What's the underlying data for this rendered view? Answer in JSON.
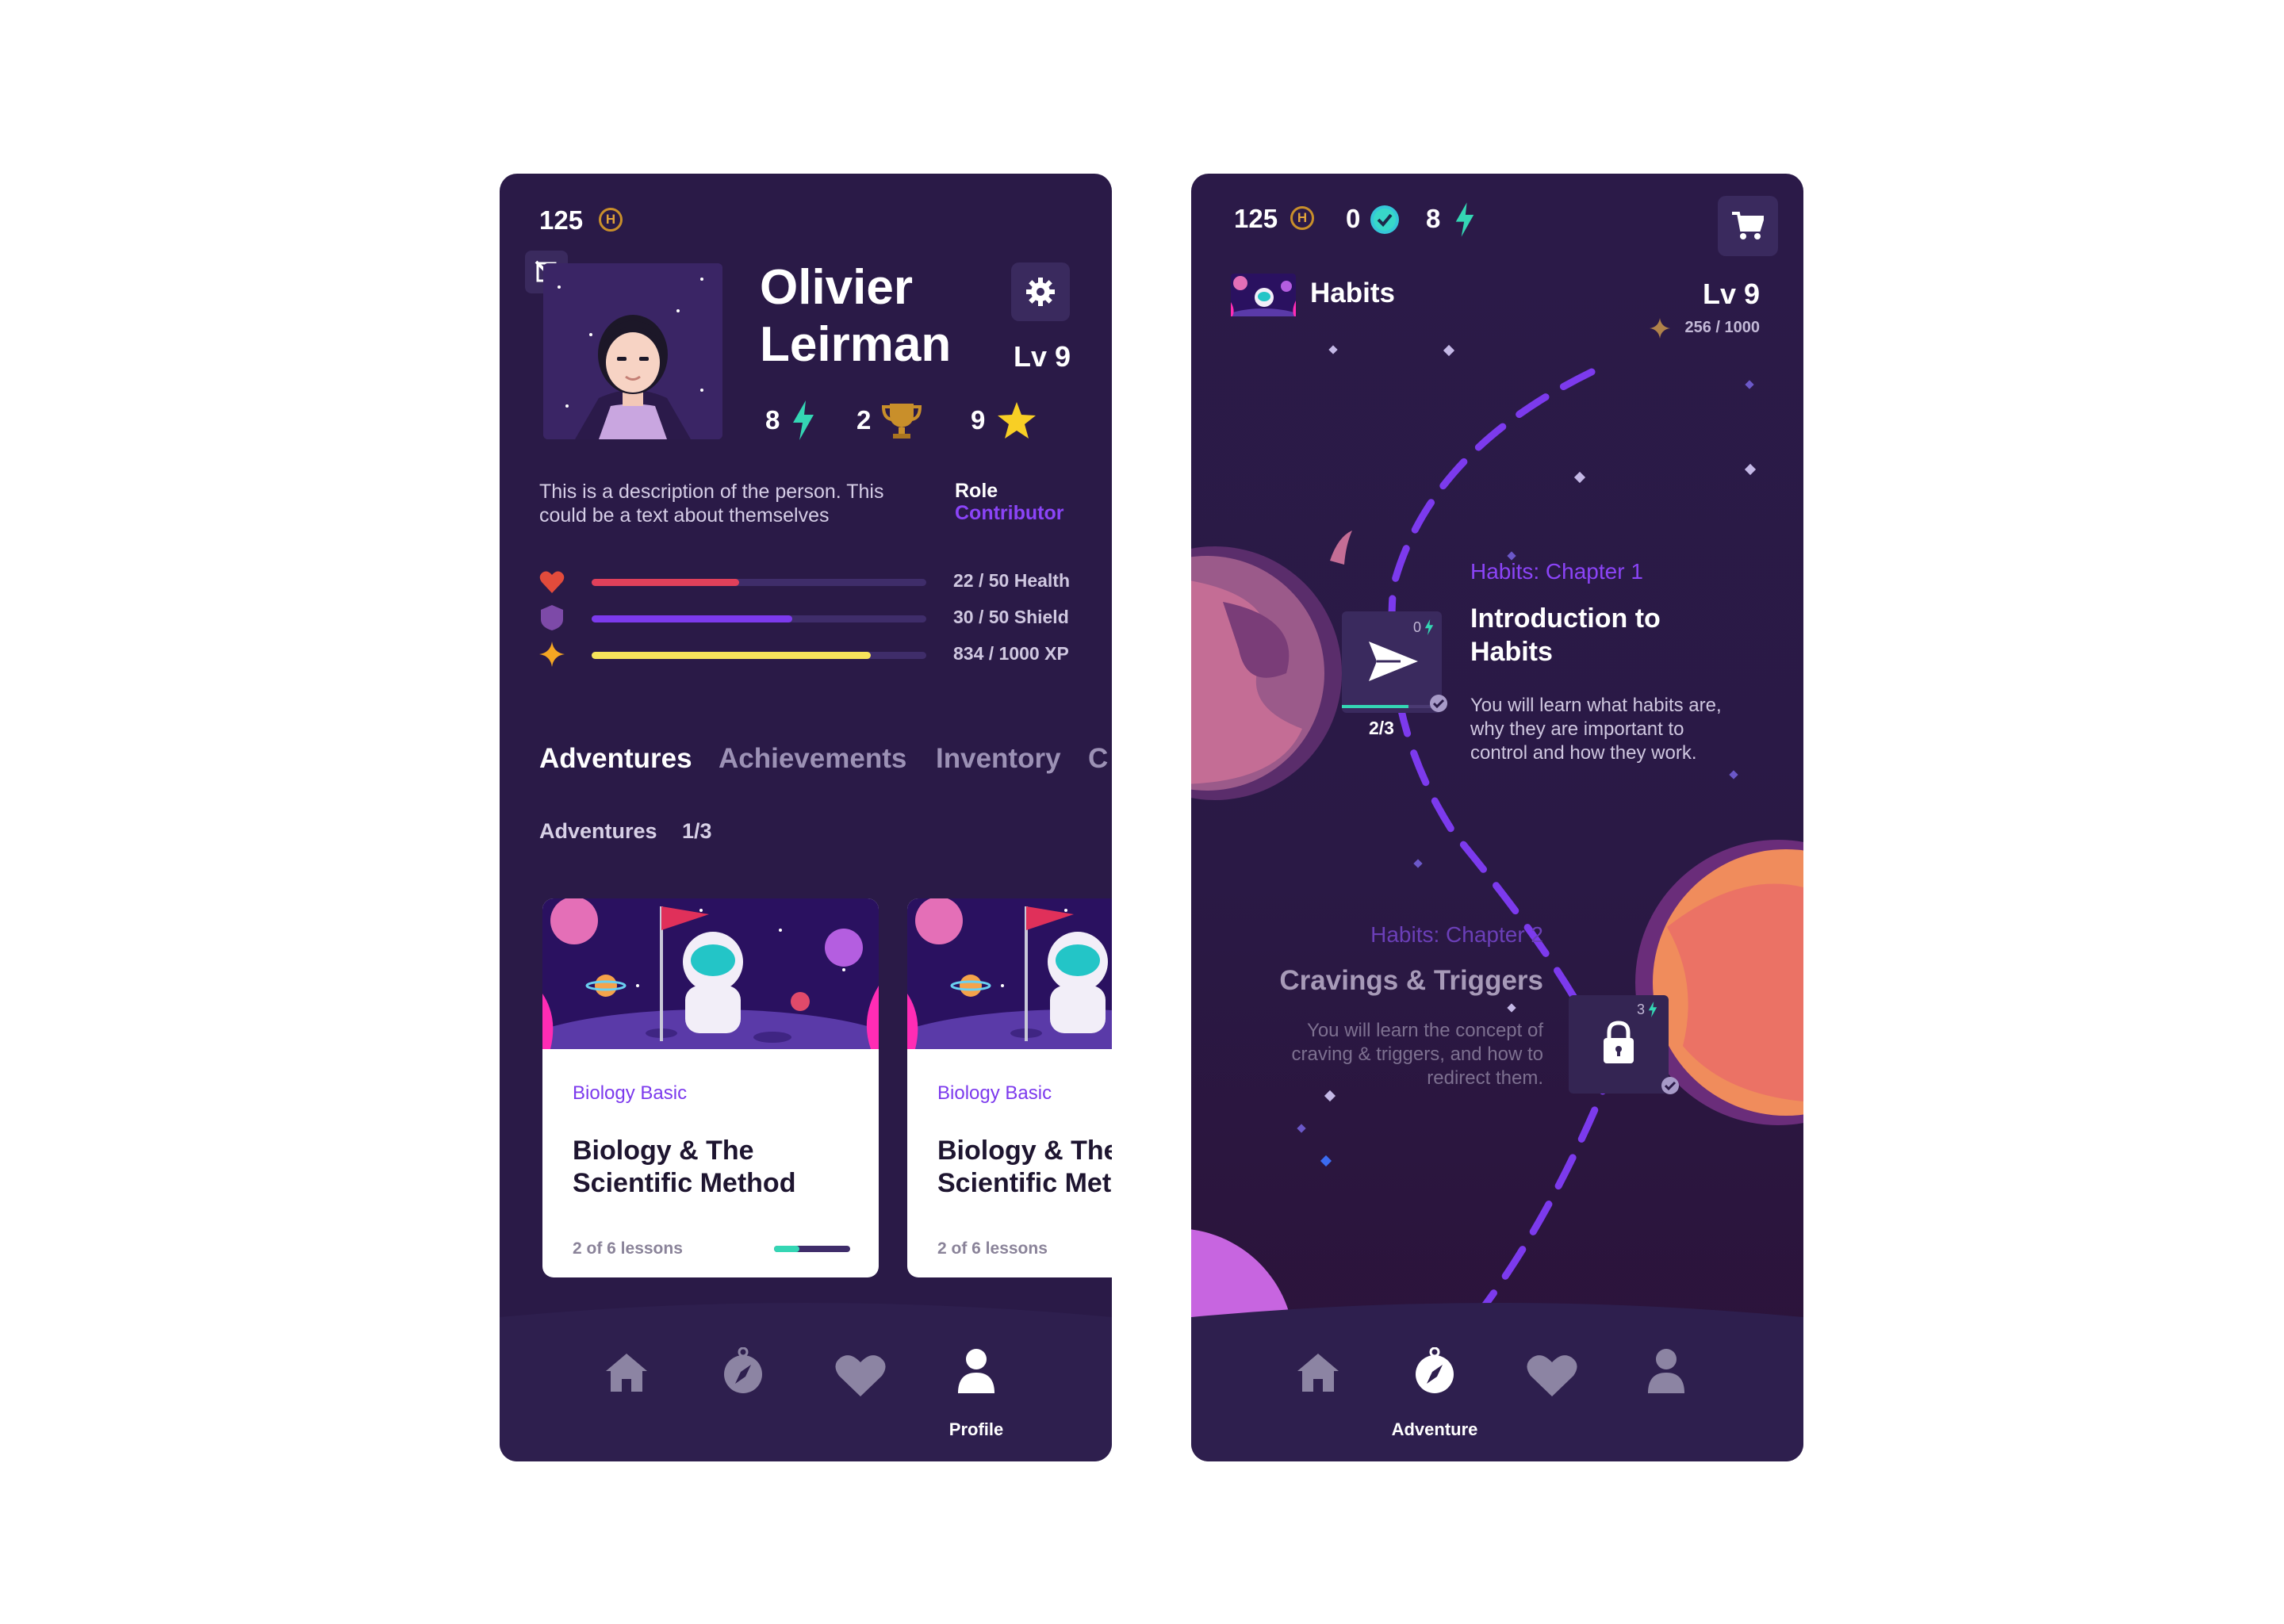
{
  "profile": {
    "coins": "125",
    "coin_symbol": "H",
    "name_line1": "Olivier",
    "name_line2": "Leirman",
    "level": "Lv 9",
    "energy": "8",
    "trophies": "2",
    "stars": "9",
    "description_line1": "This is a description of the person. This",
    "description_line2": "could be a text about themselves",
    "role_label": "Role",
    "role_value": "Contributor",
    "stats": [
      {
        "label": "22 / 50 Health",
        "fraction": 0.44,
        "color": "#e0405a"
      },
      {
        "label": "30 / 50 Shield",
        "fraction": 0.6,
        "color": "#7c3aed"
      },
      {
        "label": "834 / 1000 XP",
        "fraction": 0.834,
        "color": "#f7e45b"
      }
    ],
    "tabs": [
      "Adventures",
      "Achievements",
      "Inventory",
      "C"
    ],
    "section_label": "Adventures",
    "section_count": "1/3",
    "cards": [
      {
        "category": "Biology Basic",
        "title_line1": "Biology & The",
        "title_line2": "Scientific Method",
        "lessons": "2 of 6 lessons",
        "progress": 0.33
      },
      {
        "category": "Biology Basic",
        "title_line1": "Biology & The",
        "title_line2": "Scientific Met",
        "lessons": "2 of 6 lessons"
      }
    ],
    "nav_active_label": "Profile"
  },
  "adventure": {
    "coins": "125",
    "coin_symbol": "H",
    "checks": "0",
    "energy": "8",
    "course_title": "Habits",
    "level": "Lv 9",
    "xp": "256 / 1000",
    "chapter1": {
      "kicker": "Habits: Chapter 1",
      "title_line1": "Introduction to",
      "title_line2": "Habits",
      "desc_line1": "You will learn what habits are,",
      "desc_line2": "why they are important to",
      "desc_line3": "control and how they work.",
      "node_cost": "0",
      "node_progress": "2/3",
      "progress_fraction": 0.67
    },
    "chapter2": {
      "kicker": "Habits: Chapter 2",
      "title": "Cravings & Triggers",
      "desc_line1": "You will learn the concept of",
      "desc_line2": "craving & triggers, and how to",
      "desc_line3": "redirect them.",
      "node_cost": "3"
    },
    "nav_active_label": "Adventure"
  },
  "colors": {
    "background": "#2a1a47",
    "accent": "#7c3aed",
    "teal": "#34d6b4",
    "gold": "#e0a23a"
  }
}
